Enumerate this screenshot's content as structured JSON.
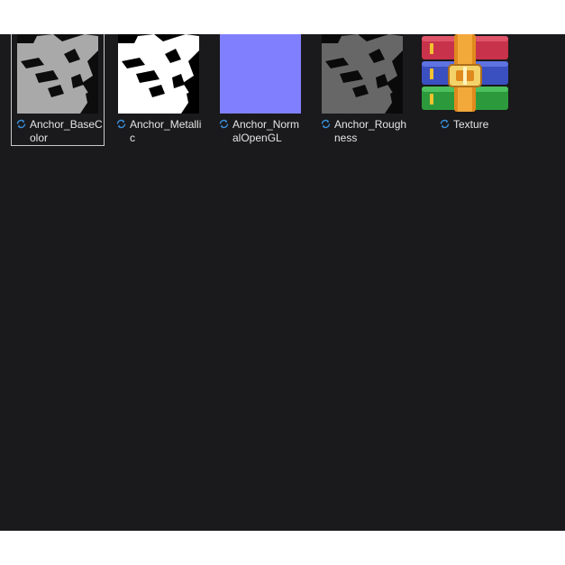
{
  "window": {
    "background": "#1a191b"
  },
  "files": [
    {
      "name_line1": "Anchor_BaseC",
      "name_line2": "olor",
      "thumb_icon": "anchor-basecolor-texture-thumbnail",
      "status_icon": "sync-pending-icon",
      "selected": true
    },
    {
      "name_line1": "Anchor_Metalli",
      "name_line2": "c",
      "thumb_icon": "anchor-metallic-texture-thumbnail",
      "status_icon": "sync-pending-icon",
      "selected": false
    },
    {
      "name_line1": "Anchor_Norm",
      "name_line2": "alOpenGL",
      "thumb_icon": "anchor-normal-texture-thumbnail",
      "status_icon": "sync-pending-icon",
      "selected": false
    },
    {
      "name_line1": "Anchor_Rough",
      "name_line2": "ness",
      "thumb_icon": "anchor-roughness-texture-thumbnail",
      "status_icon": "sync-pending-icon",
      "selected": false
    },
    {
      "name_line1": "Texture",
      "name_line2": "",
      "thumb_icon": "winrar-archive-icon",
      "status_icon": "sync-pending-icon",
      "selected": false
    }
  ],
  "colors": {
    "label_text": "#e6e6e6",
    "sync_icon": "#3a8fd8",
    "normal_map": "#8080ff"
  }
}
